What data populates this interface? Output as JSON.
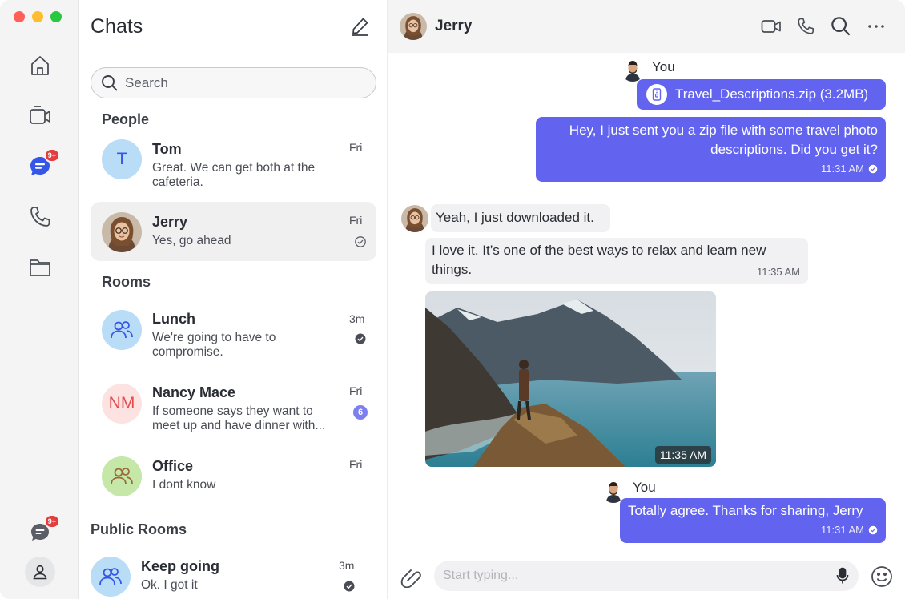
{
  "rail": {
    "nav": [
      {
        "name": "home-icon"
      },
      {
        "name": "video-icon"
      },
      {
        "name": "chat-icon",
        "badge": "9+"
      },
      {
        "name": "phone-icon"
      },
      {
        "name": "folder-icon"
      }
    ],
    "bottom_badge": "9+",
    "accent": "#3556e8"
  },
  "list": {
    "title": "Chats",
    "search_placeholder": "Search",
    "sections": {
      "people": "People",
      "rooms": "Rooms",
      "public_rooms": "Public Rooms"
    },
    "people": [
      {
        "name": "Tom",
        "initials": "T",
        "preview": "Great. We can get both at the cafeteria.",
        "time": "Fri"
      },
      {
        "name": "Jerry",
        "preview": "Yes, go ahead",
        "time": "Fri",
        "status": "read-icon"
      }
    ],
    "rooms": [
      {
        "name": "Lunch",
        "preview": "We're going to have to compromise.",
        "time": "3m",
        "status": "delivered-icon"
      },
      {
        "name": "Nancy Mace",
        "initials": "NM",
        "preview": "If someone says they want to meet up and have dinner with...",
        "time": "Fri",
        "unread": "6"
      },
      {
        "name": "Office",
        "preview": "I dont know",
        "time": "Fri"
      }
    ],
    "public_rooms": [
      {
        "name": "Keep going",
        "preview": "Ok. I got it",
        "time": "3m",
        "status": "delivered-icon"
      }
    ]
  },
  "conversation": {
    "contact": "Jerry",
    "messages": {
      "you_label": "You",
      "file_name": "Travel_Descriptions.zip (3.2MB)",
      "out1_text": "Hey, I just sent you a zip file with some travel photo descriptions. Did you get it?",
      "out1_time": "11:31 AM",
      "in1_text": "Yeah, I just downloaded it.",
      "in2_text": "I love it. It’s one of the best ways to relax and learn new things.",
      "in2_time": "11:35 AM",
      "photo_time": "11:35 AM",
      "out2_text": "Totally agree. Thanks for sharing, Jerry",
      "out2_time": "11:31 AM"
    },
    "composer_placeholder": "Start typing..."
  },
  "colors": {
    "outgoing_bubble": "#6264f0",
    "incoming_bubble": "#f1f1f3",
    "unread_badge": "#7b7ff0",
    "notification_badge": "#e43d3d"
  }
}
